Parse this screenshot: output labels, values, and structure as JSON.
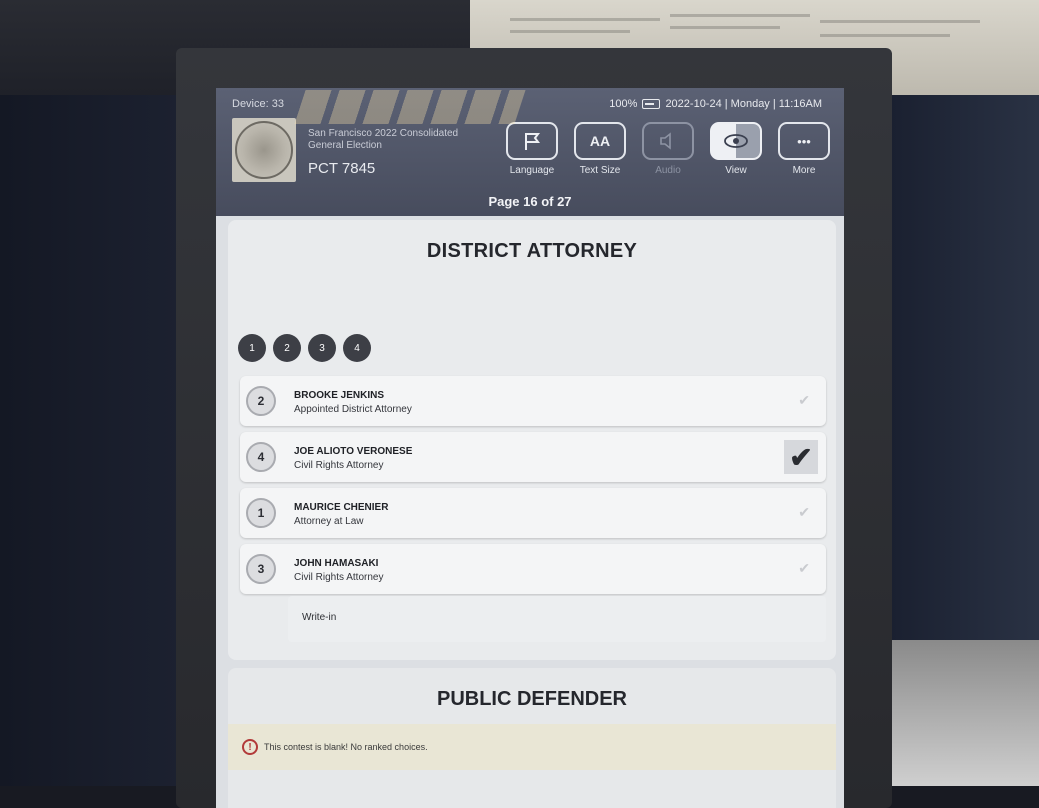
{
  "header": {
    "device": "Device: 33",
    "battery": "100%",
    "datetime": "2022-10-24 | Monday | 11:16AM",
    "election_name": "San Francisco 2022 Consolidated General Election",
    "precinct": "PCT 7845",
    "tools": [
      {
        "label": "Language",
        "icon": "flag-icon"
      },
      {
        "label": "Text Size",
        "icon": "text-size-icon",
        "glyph": "AA"
      },
      {
        "label": "Audio",
        "icon": "speaker-icon"
      },
      {
        "label": "View",
        "icon": "eye-icon"
      },
      {
        "label": "More",
        "icon": "more-icon",
        "glyph": "•••"
      }
    ],
    "page_indicator": "Page 16 of 27"
  },
  "contest": {
    "title": "DISTRICT ATTORNEY",
    "rank_buttons": [
      "1",
      "2",
      "3",
      "4"
    ],
    "candidates": [
      {
        "rank": "2",
        "name": "BROOKE JENKINS",
        "title": "Appointed District Attorney"
      },
      {
        "rank": "4",
        "name": "JOE ALIOTO VERONESE",
        "title": "Civil Rights Attorney"
      },
      {
        "rank": "1",
        "name": "MAURICE CHENIER",
        "title": "Attorney at Law"
      },
      {
        "rank": "3",
        "name": "JOHN HAMASAKI",
        "title": "Civil Rights Attorney"
      }
    ],
    "writein_label": "Write-in"
  },
  "contest2": {
    "title": "PUBLIC DEFENDER",
    "warning": "This contest is blank! No ranked choices."
  }
}
